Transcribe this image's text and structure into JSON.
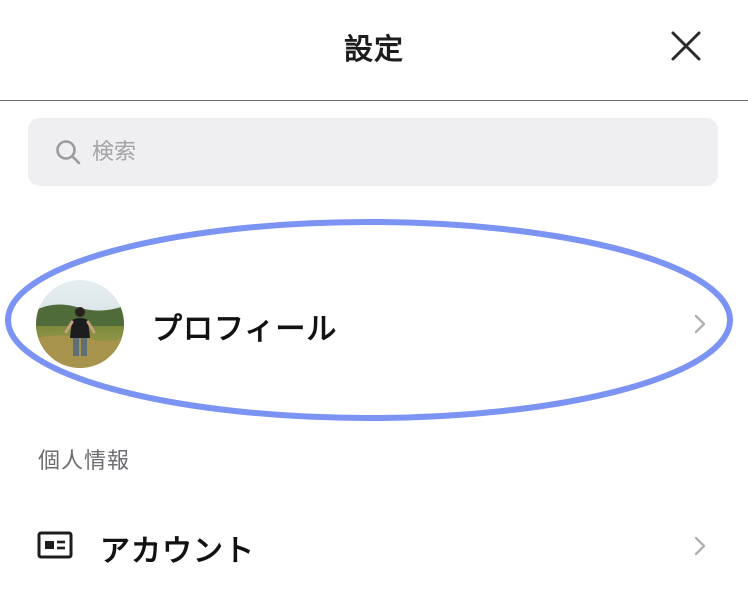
{
  "header": {
    "title": "設定",
    "close_icon": "close-icon"
  },
  "search": {
    "placeholder": "検索",
    "value": "",
    "icon": "search-icon"
  },
  "profile": {
    "label": "プロフィール",
    "avatar": "avatar-photo",
    "chevron_icon": "chevron-right-icon",
    "highlight_color": "#7b93f2"
  },
  "sections": [
    {
      "header": "個人情報",
      "items": [
        {
          "label": "アカウント",
          "icon": "id-card-icon",
          "chevron_icon": "chevron-right-icon"
        }
      ]
    }
  ],
  "colors": {
    "divider": "#6e6e6e",
    "search_bg": "#efeff1",
    "placeholder": "#a3a3a8",
    "section_text": "#6d6d72",
    "chevron": "#b0b0b5"
  }
}
